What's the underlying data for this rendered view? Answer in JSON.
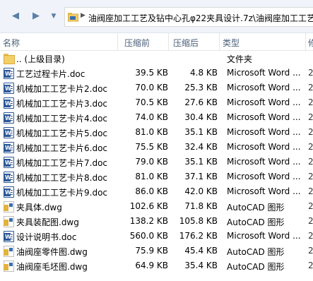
{
  "address": {
    "path": "油阀座加工工艺及钻中心孔φ22夹具设计.7z\\油阀座加工工艺及"
  },
  "columns": {
    "name": "名称",
    "compressed": "压缩前",
    "size": "压缩后",
    "type": "类型",
    "date": "修"
  },
  "rows": [
    {
      "icon": "folder-icon",
      "name": ".. (上级目录)",
      "compressed": "",
      "size": "",
      "type": "文件夹",
      "date": ""
    },
    {
      "icon": "doc-icon",
      "name": "工艺过程卡片.doc",
      "compressed": "39.5 KB",
      "size": "4.8 KB",
      "type": "Microsoft Word ...",
      "date": "2"
    },
    {
      "icon": "doc-icon",
      "name": "机械加工工艺卡片2.doc",
      "compressed": "70.0 KB",
      "size": "25.3 KB",
      "type": "Microsoft Word ...",
      "date": "2"
    },
    {
      "icon": "doc-icon",
      "name": "机械加工工艺卡片3.doc",
      "compressed": "70.5 KB",
      "size": "27.6 KB",
      "type": "Microsoft Word ...",
      "date": "2"
    },
    {
      "icon": "doc-icon",
      "name": "机械加工工艺卡片4.doc",
      "compressed": "74.0 KB",
      "size": "30.4 KB",
      "type": "Microsoft Word ...",
      "date": "2"
    },
    {
      "icon": "doc-icon",
      "name": "机械加工工艺卡片5.doc",
      "compressed": "81.0 KB",
      "size": "35.1 KB",
      "type": "Microsoft Word ...",
      "date": "2"
    },
    {
      "icon": "doc-icon",
      "name": "机械加工工艺卡片6.doc",
      "compressed": "75.5 KB",
      "size": "32.4 KB",
      "type": "Microsoft Word ...",
      "date": "2"
    },
    {
      "icon": "doc-icon",
      "name": "机械加工工艺卡片7.doc",
      "compressed": "79.0 KB",
      "size": "35.1 KB",
      "type": "Microsoft Word ...",
      "date": "2"
    },
    {
      "icon": "doc-icon",
      "name": "机械加工工艺卡片8.doc",
      "compressed": "81.0 KB",
      "size": "37.1 KB",
      "type": "Microsoft Word ...",
      "date": "2"
    },
    {
      "icon": "doc-icon",
      "name": "机械加工工艺卡片9.doc",
      "compressed": "86.0 KB",
      "size": "42.0 KB",
      "type": "Microsoft Word ...",
      "date": "2"
    },
    {
      "icon": "dwg-icon",
      "name": "夹具体.dwg",
      "compressed": "102.6 KB",
      "size": "71.8 KB",
      "type": "AutoCAD 图形",
      "date": "2"
    },
    {
      "icon": "dwg-icon",
      "name": "夹具装配图.dwg",
      "compressed": "138.2 KB",
      "size": "105.8 KB",
      "type": "AutoCAD 图形",
      "date": "2"
    },
    {
      "icon": "doc-icon",
      "name": "设计说明书.doc",
      "compressed": "560.0 KB",
      "size": "176.2 KB",
      "type": "Microsoft Word ...",
      "date": "2"
    },
    {
      "icon": "dwg-icon",
      "name": "油阀座零件图.dwg",
      "compressed": "75.9 KB",
      "size": "45.4 KB",
      "type": "AutoCAD 图形",
      "date": "2"
    },
    {
      "icon": "dwg-icon",
      "name": "油阀座毛坯图.dwg",
      "compressed": "64.9 KB",
      "size": "35.4 KB",
      "type": "AutoCAD 图形",
      "date": "2"
    }
  ]
}
